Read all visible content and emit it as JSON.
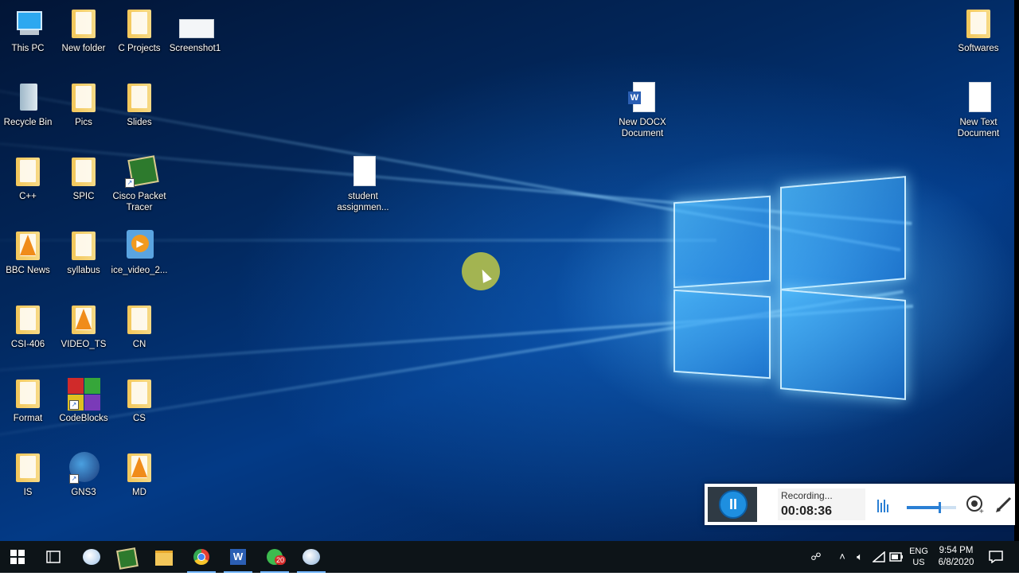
{
  "desktop": {
    "icons_col1": [
      {
        "label": "This PC",
        "type": "pc"
      },
      {
        "label": "Recycle Bin",
        "type": "bin"
      },
      {
        "label": "C++",
        "type": "folder"
      },
      {
        "label": "BBC News",
        "type": "folder-vlc"
      },
      {
        "label": "CSI-406",
        "type": "folder"
      },
      {
        "label": "Format",
        "type": "folder"
      },
      {
        "label": "IS",
        "type": "folder"
      }
    ],
    "icons_col2": [
      {
        "label": "New folder",
        "type": "folder"
      },
      {
        "label": "Pics",
        "type": "folder"
      },
      {
        "label": "SPIC",
        "type": "folder"
      },
      {
        "label": "syllabus",
        "type": "folder"
      },
      {
        "label": "VIDEO_TS",
        "type": "folder-vlc"
      },
      {
        "label": "CodeBlocks",
        "type": "app"
      },
      {
        "label": "GNS3",
        "type": "app"
      }
    ],
    "icons_col3": [
      {
        "label": "C Projects",
        "type": "folder"
      },
      {
        "label": "Slides",
        "type": "folder"
      },
      {
        "label": "Cisco Packet Tracer",
        "type": "app"
      },
      {
        "label": "ice_video_2...",
        "type": "app"
      },
      {
        "label": "CN",
        "type": "folder"
      },
      {
        "label": "CS",
        "type": "folder"
      },
      {
        "label": "MD",
        "type": "folder-vlc"
      }
    ],
    "screenshot_icon": {
      "label": "Screenshot1"
    },
    "student_icon": {
      "label": "student assignmen..."
    },
    "docx_icon": {
      "label": "New DOCX Document"
    },
    "softwares_icon": {
      "label": "Softwares"
    },
    "newtext_icon": {
      "label": "New Text Document"
    }
  },
  "recorder": {
    "status": "Recording...",
    "time": "00:08:36",
    "pause_symbol": "II"
  },
  "taskbar": {
    "whatsapp_badge": "20",
    "lang_top": "ENG",
    "lang_bottom": "US",
    "time": "9:54 PM",
    "date": "6/8/2020"
  }
}
